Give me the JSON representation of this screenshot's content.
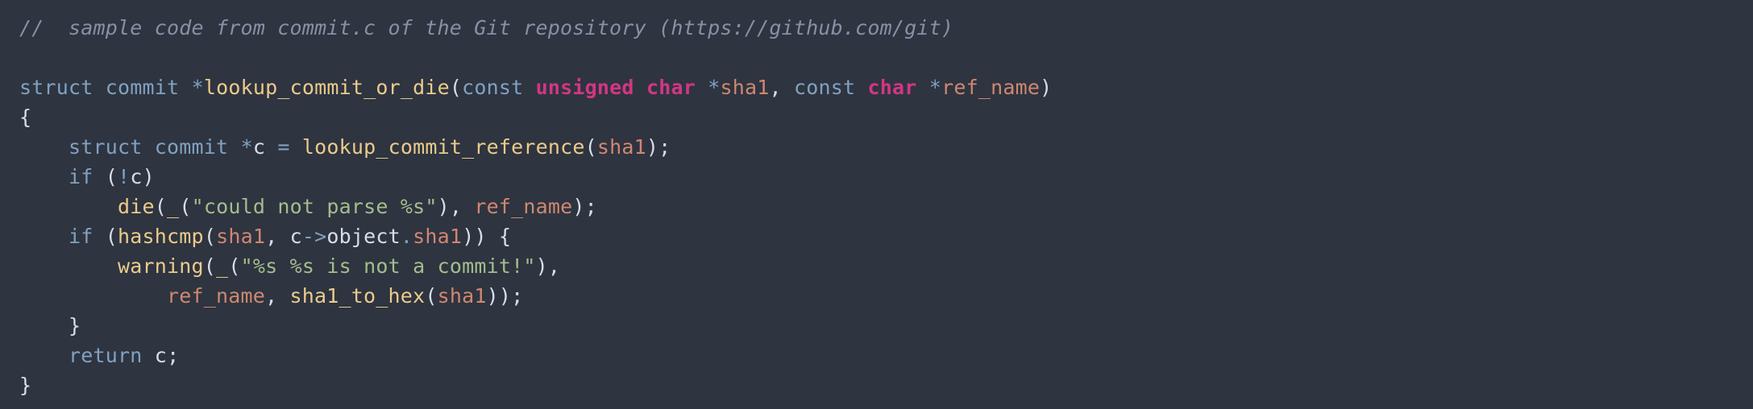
{
  "code": {
    "comment": "//  sample code from commit.c of the Git repository (https://github.com/git)",
    "l3": {
      "struct": "struct",
      "commit": "commit",
      "star": "*",
      "fn": "lookup_commit_or_die",
      "lp": "(",
      "const1": "const",
      "unsigned": "unsigned",
      "char1": "char",
      "star2": " *",
      "p1": "sha1",
      "comma": ", ",
      "const2": "const",
      "char2": "char",
      "star3": " *",
      "p2": "ref_name",
      "rp": ")"
    },
    "l4": {
      "brace": "{"
    },
    "l5": {
      "indent": "    ",
      "struct": "struct",
      "commit": "commit",
      "stareq": " *",
      "c": "c",
      "eq": " = ",
      "fn": "lookup_commit_reference",
      "lp": "(",
      "arg": "sha1",
      "rp": ");"
    },
    "l6": {
      "indent": "    ",
      "if": "if",
      "sp": " (",
      "not": "!",
      "c": "c",
      "rp": ")"
    },
    "l7": {
      "indent": "        ",
      "fn": "die",
      "lp": "(",
      "us": "_",
      "lp2": "(",
      "str": "\"could not parse %s\"",
      "rp2": "), ",
      "arg": "ref_name",
      "end": ");"
    },
    "l8": {
      "indent": "    ",
      "if": "if",
      "sp": " (",
      "fn": "hashcmp",
      "lp": "(",
      "a1": "sha1",
      "comma": ", ",
      "c": "c",
      "arrow": "->",
      "obj": "object",
      "dot": ".",
      "sha1": "sha1",
      "rp": ")) {"
    },
    "l9": {
      "indent": "        ",
      "fn": "warning",
      "lp": "(",
      "us": "_",
      "lp2": "(",
      "str": "\"%s %s is not a commit!\"",
      "rp2": "),"
    },
    "l10": {
      "indent": "            ",
      "a1": "ref_name",
      "comma": ", ",
      "fn": "sha1_to_hex",
      "lp": "(",
      "a2": "sha1",
      "rp": "));"
    },
    "l11": {
      "indent": "    ",
      "brace": "}"
    },
    "l12": {
      "indent": "    ",
      "return": "return",
      "sp": " ",
      "c": "c",
      "semi": ";"
    },
    "l13": {
      "brace": "}"
    }
  }
}
